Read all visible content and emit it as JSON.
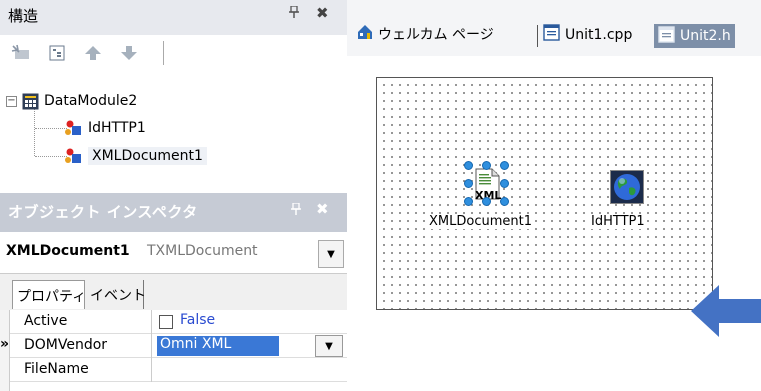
{
  "structure_panel": {
    "title": "構造",
    "pin_glyph": "📌",
    "close_glyph": "✖",
    "toolbar": [
      "new-item-icon",
      "tree-view-icon",
      "arrow-up-icon",
      "arrow-down-icon"
    ],
    "tree": {
      "root": "DataModule2",
      "children": [
        "IdHTTP1",
        "XMLDocument1"
      ]
    }
  },
  "object_inspector": {
    "title": "オブジェクト インスペクタ",
    "selected_object": "XMLDocument1",
    "selected_type": "TXMLDocument",
    "tabs": [
      "プロパティ",
      "イベント"
    ],
    "properties": [
      {
        "name": "Active",
        "value": "False",
        "kind": "checkbox"
      },
      {
        "name": "DOMVendor",
        "value": "Omni XML",
        "kind": "combo",
        "marker": "»"
      },
      {
        "name": "FileName",
        "value": "",
        "kind": "text"
      }
    ]
  },
  "editor_tabs": [
    {
      "label": "ウェルカム ページ",
      "icon": "home-icon",
      "active": false
    },
    {
      "label": "Unit1.cpp",
      "icon": "document-icon",
      "active": false
    },
    {
      "label": "Unit2.h",
      "icon": "document-icon",
      "active": true
    }
  ],
  "form_designer": {
    "components": [
      {
        "name": "XMLDocument1",
        "icon": "xml-document-icon",
        "badge": "XML",
        "selected": true
      },
      {
        "name": "IdHTTP1",
        "icon": "globe-icon",
        "selected": false
      }
    ]
  },
  "colors": {
    "accent_blue": "#3a78d6",
    "handle_blue": "#2f8fde",
    "arrow_blue": "#4472c4",
    "inspector_title_bg": "#c6cbd5",
    "active_tab_bg": "#7d8fa8"
  }
}
